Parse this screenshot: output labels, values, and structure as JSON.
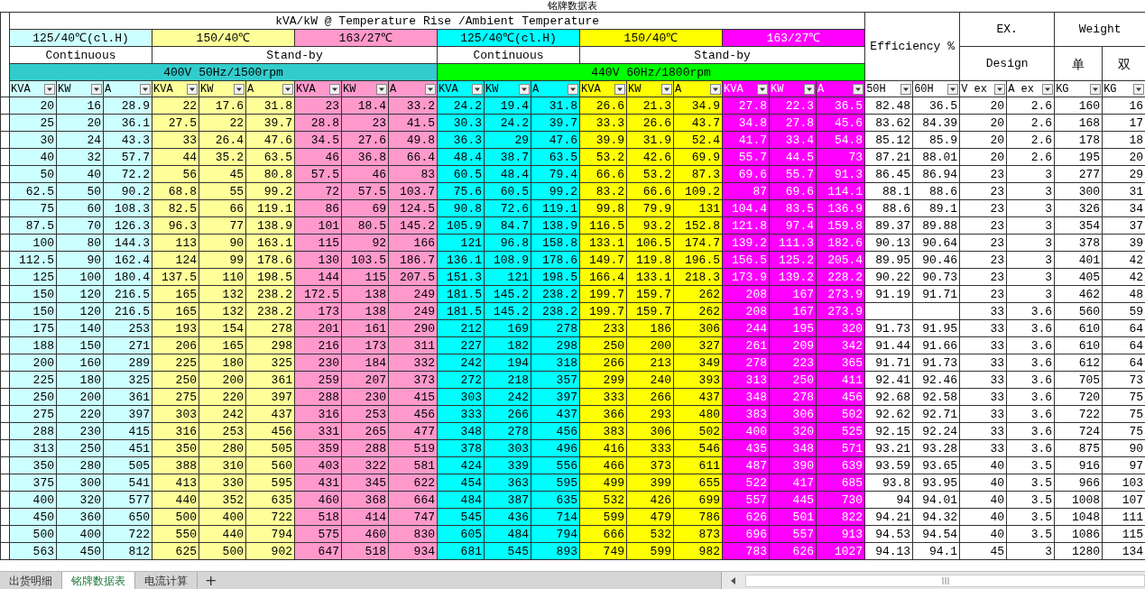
{
  "title": "铭牌数据表",
  "header": {
    "caption": "kVA/kW @ Temperature Rise /Ambient Temperature",
    "efficiency": "Efficiency %",
    "ex": "EX.",
    "ex_sub": "Design",
    "weight": "Weight",
    "weight_sub": [
      "单",
      "双"
    ]
  },
  "groups": [
    {
      "temp": "125/40℃(cl.H)",
      "color": "#ccffff",
      "inverse": false
    },
    {
      "temp": "150/40℃",
      "color": "#ffff99",
      "inverse": false
    },
    {
      "temp": "163/27℃",
      "color": "#ff99cc",
      "inverse": false
    },
    {
      "temp": "125/40℃(cl.H)",
      "color": "#00ffff",
      "inverse": false
    },
    {
      "temp": "150/40℃",
      "color": "#ffff00",
      "inverse": false
    },
    {
      "temp": "163/27℃",
      "color": "#ff00ff",
      "inverse": true
    }
  ],
  "duty": [
    "Continuous",
    "Stand-by",
    "Continuous",
    "Stand-by"
  ],
  "supplies": [
    {
      "label": "400V 50Hz/1500rpm",
      "color": "#33cccc"
    },
    {
      "label": "440V 60Hz/1800rpm",
      "color": "#00ff00"
    }
  ],
  "columns": [
    "KVA",
    "KW",
    "A",
    "KVA",
    "KW",
    "A",
    "KVA",
    "KW",
    "A",
    "KVA",
    "KW",
    "A",
    "KVA",
    "KW",
    "A",
    "KVA",
    "KW",
    "A",
    "50H",
    "60H",
    "V ex",
    "A ex",
    "KG",
    "KG"
  ],
  "rows": [
    [
      "20",
      "16",
      "28.9",
      "22",
      "17.6",
      "31.8",
      "23",
      "18.4",
      "33.2",
      "24.2",
      "19.4",
      "31.8",
      "26.6",
      "21.3",
      "34.9",
      "27.8",
      "22.3",
      "36.5",
      "82.48",
      "36.5",
      "20",
      "2.6",
      "160",
      "16"
    ],
    [
      "25",
      "20",
      "36.1",
      "27.5",
      "22",
      "39.7",
      "28.8",
      "23",
      "41.5",
      "30.3",
      "24.2",
      "39.7",
      "33.3",
      "26.6",
      "43.7",
      "34.8",
      "27.8",
      "45.6",
      "83.62",
      "84.39",
      "20",
      "2.6",
      "168",
      "17"
    ],
    [
      "30",
      "24",
      "43.3",
      "33",
      "26.4",
      "47.6",
      "34.5",
      "27.6",
      "49.8",
      "36.3",
      "29",
      "47.6",
      "39.9",
      "31.9",
      "52.4",
      "41.7",
      "33.4",
      "54.8",
      "85.12",
      "85.9",
      "20",
      "2.6",
      "178",
      "18"
    ],
    [
      "40",
      "32",
      "57.7",
      "44",
      "35.2",
      "63.5",
      "46",
      "36.8",
      "66.4",
      "48.4",
      "38.7",
      "63.5",
      "53.2",
      "42.6",
      "69.9",
      "55.7",
      "44.5",
      "73",
      "87.21",
      "88.01",
      "20",
      "2.6",
      "195",
      "20"
    ],
    [
      "50",
      "40",
      "72.2",
      "56",
      "45",
      "80.8",
      "57.5",
      "46",
      "83",
      "60.5",
      "48.4",
      "79.4",
      "66.6",
      "53.2",
      "87.3",
      "69.6",
      "55.7",
      "91.3",
      "86.45",
      "86.94",
      "23",
      "3",
      "277",
      "29"
    ],
    [
      "62.5",
      "50",
      "90.2",
      "68.8",
      "55",
      "99.2",
      "72",
      "57.5",
      "103.7",
      "75.6",
      "60.5",
      "99.2",
      "83.2",
      "66.6",
      "109.2",
      "87",
      "69.6",
      "114.1",
      "88.1",
      "88.6",
      "23",
      "3",
      "300",
      "31"
    ],
    [
      "75",
      "60",
      "108.3",
      "82.5",
      "66",
      "119.1",
      "86",
      "69",
      "124.5",
      "90.8",
      "72.6",
      "119.1",
      "99.8",
      "79.9",
      "131",
      "104.4",
      "83.5",
      "136.9",
      "88.6",
      "89.1",
      "23",
      "3",
      "326",
      "34"
    ],
    [
      "87.5",
      "70",
      "126.3",
      "96.3",
      "77",
      "138.9",
      "101",
      "80.5",
      "145.2",
      "105.9",
      "84.7",
      "138.9",
      "116.5",
      "93.2",
      "152.8",
      "121.8",
      "97.4",
      "159.8",
      "89.37",
      "89.88",
      "23",
      "3",
      "354",
      "37"
    ],
    [
      "100",
      "80",
      "144.3",
      "113",
      "90",
      "163.1",
      "115",
      "92",
      "166",
      "121",
      "96.8",
      "158.8",
      "133.1",
      "106.5",
      "174.7",
      "139.2",
      "111.3",
      "182.6",
      "90.13",
      "90.64",
      "23",
      "3",
      "378",
      "39"
    ],
    [
      "112.5",
      "90",
      "162.4",
      "124",
      "99",
      "178.6",
      "130",
      "103.5",
      "186.7",
      "136.1",
      "108.9",
      "178.6",
      "149.7",
      "119.8",
      "196.5",
      "156.5",
      "125.2",
      "205.4",
      "89.95",
      "90.46",
      "23",
      "3",
      "401",
      "42"
    ],
    [
      "125",
      "100",
      "180.4",
      "137.5",
      "110",
      "198.5",
      "144",
      "115",
      "207.5",
      "151.3",
      "121",
      "198.5",
      "166.4",
      "133.1",
      "218.3",
      "173.9",
      "139.2",
      "228.2",
      "90.22",
      "90.73",
      "23",
      "3",
      "405",
      "42"
    ],
    [
      "150",
      "120",
      "216.5",
      "165",
      "132",
      "238.2",
      "172.5",
      "138",
      "249",
      "181.5",
      "145.2",
      "238.2",
      "199.7",
      "159.7",
      "262",
      "208",
      "167",
      "273.9",
      "91.19",
      "91.71",
      "23",
      "3",
      "462",
      "48"
    ],
    [
      "150",
      "120",
      "216.5",
      "165",
      "132",
      "238.2",
      "173",
      "138",
      "249",
      "181.5",
      "145.2",
      "238.2",
      "199.7",
      "159.7",
      "262",
      "208",
      "167",
      "273.9",
      "",
      "",
      "33",
      "3.6",
      "560",
      "59"
    ],
    [
      "175",
      "140",
      "253",
      "193",
      "154",
      "278",
      "201",
      "161",
      "290",
      "212",
      "169",
      "278",
      "233",
      "186",
      "306",
      "244",
      "195",
      "320",
      "91.73",
      "91.95",
      "33",
      "3.6",
      "610",
      "64"
    ],
    [
      "188",
      "150",
      "271",
      "206",
      "165",
      "298",
      "216",
      "173",
      "311",
      "227",
      "182",
      "298",
      "250",
      "200",
      "327",
      "261",
      "209",
      "342",
      "91.44",
      "91.66",
      "33",
      "3.6",
      "610",
      "64"
    ],
    [
      "200",
      "160",
      "289",
      "225",
      "180",
      "325",
      "230",
      "184",
      "332",
      "242",
      "194",
      "318",
      "266",
      "213",
      "349",
      "278",
      "223",
      "365",
      "91.71",
      "91.73",
      "33",
      "3.6",
      "612",
      "64"
    ],
    [
      "225",
      "180",
      "325",
      "250",
      "200",
      "361",
      "259",
      "207",
      "373",
      "272",
      "218",
      "357",
      "299",
      "240",
      "393",
      "313",
      "250",
      "411",
      "92.41",
      "92.46",
      "33",
      "3.6",
      "705",
      "73"
    ],
    [
      "250",
      "200",
      "361",
      "275",
      "220",
      "397",
      "288",
      "230",
      "415",
      "303",
      "242",
      "397",
      "333",
      "266",
      "437",
      "348",
      "278",
      "456",
      "92.68",
      "92.58",
      "33",
      "3.6",
      "720",
      "75"
    ],
    [
      "275",
      "220",
      "397",
      "303",
      "242",
      "437",
      "316",
      "253",
      "456",
      "333",
      "266",
      "437",
      "366",
      "293",
      "480",
      "383",
      "306",
      "502",
      "92.62",
      "92.71",
      "33",
      "3.6",
      "722",
      "75"
    ],
    [
      "288",
      "230",
      "415",
      "316",
      "253",
      "456",
      "331",
      "265",
      "477",
      "348",
      "278",
      "456",
      "383",
      "306",
      "502",
      "400",
      "320",
      "525",
      "92.15",
      "92.24",
      "33",
      "3.6",
      "724",
      "75"
    ],
    [
      "313",
      "250",
      "451",
      "350",
      "280",
      "505",
      "359",
      "288",
      "519",
      "378",
      "303",
      "496",
      "416",
      "333",
      "546",
      "435",
      "348",
      "571",
      "93.21",
      "93.28",
      "33",
      "3.6",
      "875",
      "90"
    ],
    [
      "350",
      "280",
      "505",
      "388",
      "310",
      "560",
      "403",
      "322",
      "581",
      "424",
      "339",
      "556",
      "466",
      "373",
      "611",
      "487",
      "390",
      "639",
      "93.59",
      "93.65",
      "40",
      "3.5",
      "916",
      "97"
    ],
    [
      "375",
      "300",
      "541",
      "413",
      "330",
      "595",
      "431",
      "345",
      "622",
      "454",
      "363",
      "595",
      "499",
      "399",
      "655",
      "522",
      "417",
      "685",
      "93.8",
      "93.95",
      "40",
      "3.5",
      "966",
      "103"
    ],
    [
      "400",
      "320",
      "577",
      "440",
      "352",
      "635",
      "460",
      "368",
      "664",
      "484",
      "387",
      "635",
      "532",
      "426",
      "699",
      "557",
      "445",
      "730",
      "94",
      "94.01",
      "40",
      "3.5",
      "1008",
      "107"
    ],
    [
      "450",
      "360",
      "650",
      "500",
      "400",
      "722",
      "518",
      "414",
      "747",
      "545",
      "436",
      "714",
      "599",
      "479",
      "786",
      "626",
      "501",
      "822",
      "94.21",
      "94.32",
      "40",
      "3.5",
      "1048",
      "111"
    ],
    [
      "500",
      "400",
      "722",
      "550",
      "440",
      "794",
      "575",
      "460",
      "830",
      "605",
      "484",
      "794",
      "666",
      "532",
      "873",
      "696",
      "557",
      "913",
      "94.53",
      "94.54",
      "40",
      "3.5",
      "1086",
      "115"
    ],
    [
      "563",
      "450",
      "812",
      "625",
      "500",
      "902",
      "647",
      "518",
      "934",
      "681",
      "545",
      "893",
      "749",
      "599",
      "982",
      "783",
      "626",
      "1027",
      "94.13",
      "94.1",
      "45",
      "3",
      "1280",
      "134"
    ]
  ],
  "sheet_tabs": [
    {
      "label": "出货明细",
      "selected": false
    },
    {
      "label": "铭牌数据表",
      "selected": true
    },
    {
      "label": "电流计算",
      "selected": false
    }
  ],
  "add_sheet": "+"
}
